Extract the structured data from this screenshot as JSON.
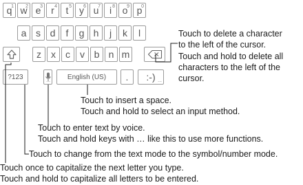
{
  "keyboard": {
    "row1": [
      {
        "label": "q",
        "sup": "1"
      },
      {
        "label": "w",
        "sup": "2"
      },
      {
        "label": "e",
        "sup": "3"
      },
      {
        "label": "r",
        "sup": "4"
      },
      {
        "label": "t",
        "sup": "5"
      },
      {
        "label": "y",
        "sup": "6"
      },
      {
        "label": "u",
        "sup": "7"
      },
      {
        "label": "i",
        "sup": "8"
      },
      {
        "label": "o",
        "sup": "9"
      },
      {
        "label": "p",
        "sup": "0"
      }
    ],
    "row2": [
      "a",
      "s",
      "d",
      "f",
      "g",
      "h",
      "j",
      "k",
      "l"
    ],
    "row3": [
      "z",
      "x",
      "c",
      "v",
      "b",
      "n",
      "m"
    ],
    "symbols_key": "?123",
    "space_key": "English (US)",
    "period_key": ".",
    "emoticon_key": ":-)",
    "more_marker": "...",
    "icons": {
      "shift": "shift-arrow-icon",
      "delete": "backspace-icon",
      "voice": "microphone-icon"
    }
  },
  "annotations": {
    "delete": [
      "Touch to delete a character",
      "to the left of the cursor.",
      "Touch and hold to delete all",
      "characters to the left of the",
      "cursor."
    ],
    "space": [
      "Touch to insert a space.",
      "Touch and hold to select an input method."
    ],
    "voice": [
      "Touch to enter text by voice.",
      "Touch and hold keys with … like this to use more functions."
    ],
    "symbols": [
      "Touch to change from the text mode to the symbol/number mode."
    ],
    "shift": [
      "Touch once to capitalize the next letter you type.",
      "Touch and hold to capitalize all letters to be entered."
    ]
  }
}
